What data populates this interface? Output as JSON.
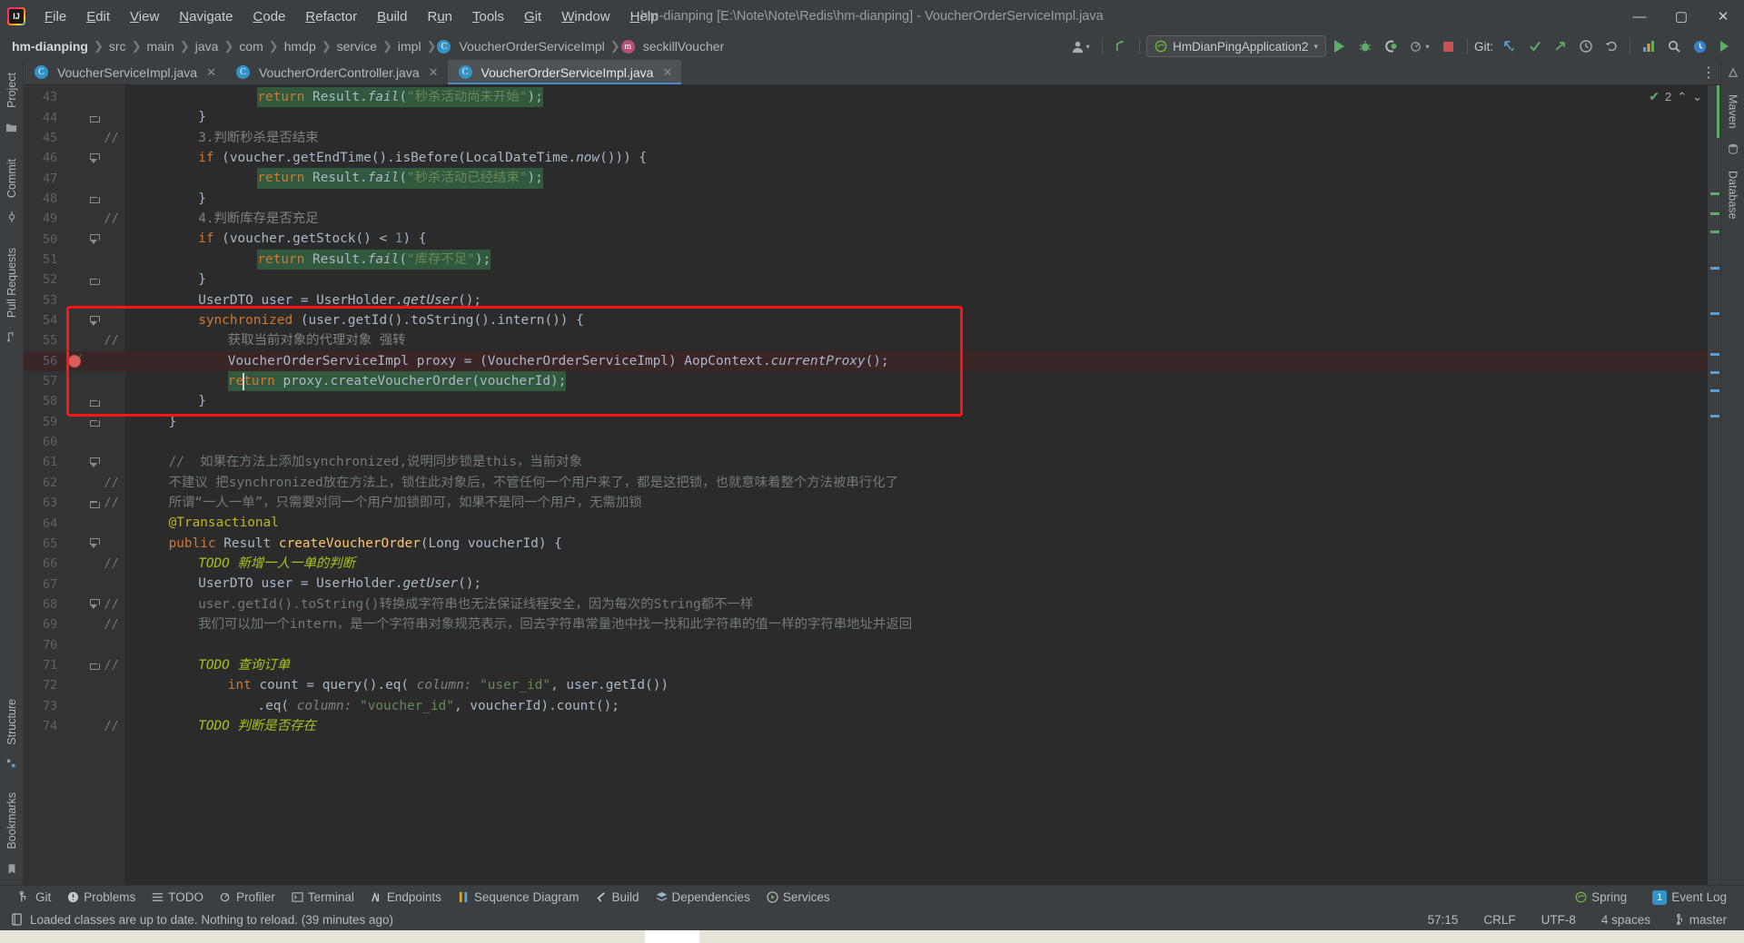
{
  "window": {
    "title": "hm-dianping [E:\\Note\\Note\\Redis\\hm-dianping] - VoucherOrderServiceImpl.java",
    "minimize": "—",
    "maximize": "▢",
    "close": "✕"
  },
  "menubar": {
    "items": [
      "File",
      "Edit",
      "View",
      "Navigate",
      "Code",
      "Refactor",
      "Build",
      "Run",
      "Tools",
      "Git",
      "Window",
      "Help"
    ]
  },
  "breadcrumb": {
    "items": [
      {
        "label": "hm-dianping",
        "icon": "",
        "bold": true
      },
      {
        "label": "src",
        "icon": "",
        "bold": false
      },
      {
        "label": "main",
        "icon": "",
        "bold": false
      },
      {
        "label": "java",
        "icon": "",
        "bold": false
      },
      {
        "label": "com",
        "icon": "",
        "bold": false
      },
      {
        "label": "hmdp",
        "icon": "",
        "bold": false
      },
      {
        "label": "service",
        "icon": "",
        "bold": false
      },
      {
        "label": "impl",
        "icon": "",
        "bold": false
      },
      {
        "label": "VoucherOrderServiceImpl",
        "icon": "C",
        "bold": false
      },
      {
        "label": "seckillVoucher",
        "icon": "m",
        "bold": false
      }
    ],
    "separator": "❯"
  },
  "toolbar": {
    "run_config": "HmDianPingApplication2",
    "run_config_caret": "▾",
    "git_label": "Git:",
    "avatar_caret": "▾",
    "profiler_caret": "▾",
    "icons": {
      "run": "run-icon",
      "debug": "debug-icon",
      "coverage": "coverage-icon",
      "profile": "profile-icon",
      "stop": "stop-icon",
      "update": "git-update-icon",
      "commit": "git-commit-icon",
      "push": "git-push-icon",
      "history": "history-icon",
      "rollback": "rollback-icon",
      "analyze": "analyze-icon",
      "search": "search-icon",
      "settings": "settings-icon",
      "play_all": "play-all-icon"
    }
  },
  "tabs": [
    {
      "label": "VoucherServiceImpl.java",
      "icon": "C",
      "active": false,
      "close": "✕"
    },
    {
      "label": "VoucherOrderController.java",
      "icon": "C",
      "active": false,
      "close": "✕"
    },
    {
      "label": "VoucherOrderServiceImpl.java",
      "icon": "C",
      "active": true,
      "close": "✕"
    }
  ],
  "tab_overflow": "⋮",
  "left_rail": [
    {
      "label": "Project",
      "icon": "project-icon"
    },
    {
      "label": "Commit",
      "icon": "commit-icon"
    },
    {
      "label": "Pull Requests",
      "icon": "pull-requests-icon"
    },
    {
      "label": "Structure",
      "icon": "structure-icon"
    },
    {
      "label": "Bookmarks",
      "icon": "bookmarks-icon"
    }
  ],
  "right_rail": [
    {
      "label": "Maven",
      "icon": "maven-icon"
    },
    {
      "label": "Database",
      "icon": "database-icon"
    }
  ],
  "inspection": {
    "warning_count": "2",
    "ok_icon": "✔",
    "up_arrow": "⌃",
    "down_arrow": "⌄"
  },
  "editor": {
    "lines": [
      {
        "n": "43",
        "fold": "",
        "cmt": "",
        "bp": false,
        "indent": 4,
        "highlight": "",
        "tokens": [
          {
            "t": "return ",
            "c": "kw"
          },
          {
            "t": "Result.",
            "c": "ident"
          },
          {
            "t": "fail",
            "c": "methi"
          },
          {
            "t": "(",
            "c": "ident"
          },
          {
            "t": "\"秒杀活动尚未开始\"",
            "c": "str"
          },
          {
            "t": ");",
            "c": "ident"
          }
        ],
        "strbg": true
      },
      {
        "n": "44",
        "fold": "close",
        "cmt": "",
        "bp": false,
        "indent": 2,
        "highlight": "",
        "tokens": [
          {
            "t": "}",
            "c": "ident"
          }
        ]
      },
      {
        "n": "45",
        "fold": "",
        "cmt": "//",
        "bp": false,
        "indent": 2,
        "highlight": "",
        "tokens": [
          {
            "t": "3.判断秒杀是否结束",
            "c": "cmt"
          }
        ]
      },
      {
        "n": "46",
        "fold": "open",
        "cmt": "",
        "bp": false,
        "indent": 2,
        "highlight": "",
        "tokens": [
          {
            "t": "if",
            "c": "kw"
          },
          {
            "t": " (voucher.",
            "c": "ident"
          },
          {
            "t": "getEndTime",
            "c": "ident"
          },
          {
            "t": "().",
            "c": "ident"
          },
          {
            "t": "isBefore",
            "c": "ident"
          },
          {
            "t": "(LocalDateTime.",
            "c": "ident"
          },
          {
            "t": "now",
            "c": "methi"
          },
          {
            "t": "())) {",
            "c": "ident"
          }
        ]
      },
      {
        "n": "47",
        "fold": "",
        "cmt": "",
        "bp": false,
        "indent": 4,
        "highlight": "",
        "tokens": [
          {
            "t": "return ",
            "c": "kw"
          },
          {
            "t": "Result.",
            "c": "ident"
          },
          {
            "t": "fail",
            "c": "methi"
          },
          {
            "t": "(",
            "c": "ident"
          },
          {
            "t": "\"秒杀活动已经结束\"",
            "c": "str"
          },
          {
            "t": ");",
            "c": "ident"
          }
        ],
        "strbg": true
      },
      {
        "n": "48",
        "fold": "close",
        "cmt": "",
        "bp": false,
        "indent": 2,
        "highlight": "",
        "tokens": [
          {
            "t": "}",
            "c": "ident"
          }
        ]
      },
      {
        "n": "49",
        "fold": "",
        "cmt": "//",
        "bp": false,
        "indent": 2,
        "highlight": "",
        "tokens": [
          {
            "t": "4.判断库存是否充足",
            "c": "cmt"
          }
        ]
      },
      {
        "n": "50",
        "fold": "open",
        "cmt": "",
        "bp": false,
        "indent": 2,
        "highlight": "",
        "tokens": [
          {
            "t": "if",
            "c": "kw"
          },
          {
            "t": " (voucher.",
            "c": "ident"
          },
          {
            "t": "getStock",
            "c": "ident"
          },
          {
            "t": "() < ",
            "c": "ident"
          },
          {
            "t": "1",
            "c": "num"
          },
          {
            "t": ") {",
            "c": "ident"
          }
        ]
      },
      {
        "n": "51",
        "fold": "",
        "cmt": "",
        "bp": false,
        "indent": 4,
        "highlight": "",
        "tokens": [
          {
            "t": "return ",
            "c": "kw"
          },
          {
            "t": "Result.",
            "c": "ident"
          },
          {
            "t": "fail",
            "c": "methi"
          },
          {
            "t": "(",
            "c": "ident"
          },
          {
            "t": "\"库存不足\"",
            "c": "str"
          },
          {
            "t": ");",
            "c": "ident"
          }
        ],
        "strbg": true
      },
      {
        "n": "52",
        "fold": "close",
        "cmt": "",
        "bp": false,
        "indent": 2,
        "highlight": "",
        "tokens": [
          {
            "t": "}",
            "c": "ident"
          }
        ]
      },
      {
        "n": "53",
        "fold": "",
        "cmt": "",
        "bp": false,
        "indent": 2,
        "highlight": "",
        "tokens": [
          {
            "t": "UserDTO user = UserHolder.",
            "c": "ident"
          },
          {
            "t": "getUser",
            "c": "methi"
          },
          {
            "t": "();",
            "c": "ident"
          }
        ]
      },
      {
        "n": "54",
        "fold": "open",
        "cmt": "",
        "bp": false,
        "indent": 2,
        "highlight": "",
        "tokens": [
          {
            "t": "synchronized",
            "c": "kw"
          },
          {
            "t": " (user.",
            "c": "ident"
          },
          {
            "t": "getId",
            "c": "ident"
          },
          {
            "t": "().",
            "c": "ident"
          },
          {
            "t": "toString",
            "c": "ident"
          },
          {
            "t": "().",
            "c": "ident"
          },
          {
            "t": "intern",
            "c": "ident"
          },
          {
            "t": "()) {",
            "c": "ident"
          }
        ]
      },
      {
        "n": "55",
        "fold": "",
        "cmt": "//",
        "bp": false,
        "indent": 3,
        "highlight": "",
        "tokens": [
          {
            "t": "获取当前对象的代理对象 强转",
            "c": "cmt"
          }
        ]
      },
      {
        "n": "56",
        "fold": "",
        "cmt": "",
        "bp": true,
        "indent": 3,
        "highlight": "bp",
        "tokens": [
          {
            "t": "VoucherOrderServiceImpl proxy = (VoucherOrderServiceImpl) AopContext.",
            "c": "ident"
          },
          {
            "t": "currentProxy",
            "c": "methi"
          },
          {
            "t": "();",
            "c": "ident"
          }
        ]
      },
      {
        "n": "57",
        "fold": "",
        "cmt": "",
        "bp": false,
        "indent": 3,
        "highlight": "",
        "tokens": [
          {
            "t": "return",
            "c": "kw"
          },
          {
            "t": " proxy.",
            "c": "ident"
          },
          {
            "t": "createVoucherOrder",
            "c": "ident"
          },
          {
            "t": "(voucherId);",
            "c": "ident"
          }
        ],
        "strbg": true,
        "caret": true
      },
      {
        "n": "58",
        "fold": "close",
        "cmt": "",
        "bp": false,
        "indent": 2,
        "highlight": "",
        "tokens": [
          {
            "t": "}",
            "c": "ident"
          }
        ]
      },
      {
        "n": "59",
        "fold": "close",
        "cmt": "",
        "bp": false,
        "indent": 1,
        "highlight": "",
        "tokens": [
          {
            "t": "}",
            "c": "ident"
          }
        ]
      },
      {
        "n": "60",
        "fold": "",
        "cmt": "",
        "bp": false,
        "indent": 0,
        "highlight": "",
        "tokens": []
      },
      {
        "n": "61",
        "fold": "open",
        "cmt": "",
        "bp": false,
        "indent": 1,
        "highlight": "",
        "tokens": [
          {
            "t": "//  如果在方法上添加synchronized,说明同步锁是this，当前对象",
            "c": "cmt2"
          }
        ]
      },
      {
        "n": "62",
        "fold": "",
        "cmt": "//",
        "bp": false,
        "indent": 1,
        "highlight": "",
        "tokens": [
          {
            "t": "不建议 把synchronized放在方法上，锁住此对象后，不管任何一个用户来了，都是这把锁，也就意味着整个方法被串行化了",
            "c": "cmt2"
          }
        ]
      },
      {
        "n": "63",
        "fold": "close",
        "cmt": "//",
        "bp": false,
        "indent": 1,
        "highlight": "",
        "tokens": [
          {
            "t": "所谓“一人一单”，只需要对同一个用户加锁即可，如果不是同一个用户，无需加锁",
            "c": "cmt2"
          }
        ]
      },
      {
        "n": "64",
        "fold": "",
        "cmt": "",
        "bp": false,
        "indent": 1,
        "highlight": "",
        "tokens": [
          {
            "t": "@Transactional",
            "c": "anno"
          }
        ]
      },
      {
        "n": "65",
        "fold": "open",
        "cmt": "",
        "bp": false,
        "indent": 1,
        "highlight": "",
        "tokens": [
          {
            "t": "public ",
            "c": "kw"
          },
          {
            "t": "Result ",
            "c": "ident"
          },
          {
            "t": "createVoucherOrder",
            "c": "meth"
          },
          {
            "t": "(Long voucherId) {",
            "c": "ident"
          }
        ]
      },
      {
        "n": "66",
        "fold": "",
        "cmt": "//",
        "bp": false,
        "indent": 2,
        "highlight": "",
        "tokens": [
          {
            "t": "TODO ",
            "c": "todo"
          },
          {
            "t": "新增一人一单的判断",
            "c": "todo"
          }
        ]
      },
      {
        "n": "67",
        "fold": "",
        "cmt": "",
        "bp": false,
        "indent": 2,
        "highlight": "",
        "tokens": [
          {
            "t": "UserDTO user = UserHolder.",
            "c": "ident"
          },
          {
            "t": "getUser",
            "c": "methi"
          },
          {
            "t": "();",
            "c": "ident"
          }
        ]
      },
      {
        "n": "68",
        "fold": "open",
        "cmt": "//",
        "bp": false,
        "indent": 2,
        "highlight": "",
        "tokens": [
          {
            "t": "user.getId().toString()转换成字符串也无法保证线程安全，因为每次的String都不一样",
            "c": "cmt2"
          }
        ]
      },
      {
        "n": "69",
        "fold": "",
        "cmt": "//",
        "bp": false,
        "indent": 2,
        "highlight": "",
        "tokens": [
          {
            "t": "我们可以加一个intern，是一个字符串对象规范表示，回去字符串常量池中找一找和此字符串的值一样的字符串地址并返回",
            "c": "cmt2"
          }
        ]
      },
      {
        "n": "70",
        "fold": "",
        "cmt": "",
        "bp": false,
        "indent": 0,
        "highlight": "",
        "tokens": []
      },
      {
        "n": "71",
        "fold": "close",
        "cmt": "//",
        "bp": false,
        "indent": 2,
        "highlight": "",
        "tokens": [
          {
            "t": "TODO ",
            "c": "todo"
          },
          {
            "t": "查询订单",
            "c": "todo"
          }
        ]
      },
      {
        "n": "72",
        "fold": "",
        "cmt": "",
        "bp": false,
        "indent": 3,
        "highlight": "",
        "tokens": [
          {
            "t": "int ",
            "c": "kw"
          },
          {
            "t": "count = ",
            "c": "ident"
          },
          {
            "t": "query",
            "c": "ident"
          },
          {
            "t": "().",
            "c": "ident"
          },
          {
            "t": "eq",
            "c": "ident"
          },
          {
            "t": "( ",
            "c": "ident"
          },
          {
            "t": "column:",
            "c": "param"
          },
          {
            "t": " ",
            "c": "ident"
          },
          {
            "t": "\"user_id\"",
            "c": "str"
          },
          {
            "t": ", user.",
            "c": "ident"
          },
          {
            "t": "getId",
            "c": "ident"
          },
          {
            "t": "())",
            "c": "ident"
          }
        ]
      },
      {
        "n": "73",
        "fold": "",
        "cmt": "",
        "bp": false,
        "indent": 4,
        "highlight": "",
        "tokens": [
          {
            "t": ".",
            "c": "ident"
          },
          {
            "t": "eq",
            "c": "ident"
          },
          {
            "t": "( ",
            "c": "ident"
          },
          {
            "t": "column:",
            "c": "param"
          },
          {
            "t": " ",
            "c": "ident"
          },
          {
            "t": "\"voucher_id\"",
            "c": "str"
          },
          {
            "t": ", voucherId).",
            "c": "ident"
          },
          {
            "t": "count",
            "c": "ident"
          },
          {
            "t": "();",
            "c": "ident"
          }
        ]
      },
      {
        "n": "74",
        "fold": "",
        "cmt": "//",
        "bp": false,
        "indent": 2,
        "highlight": "",
        "tokens": [
          {
            "t": "TODO ",
            "c": "todo"
          },
          {
            "t": "判断是否存在",
            "c": "todo"
          }
        ]
      }
    ],
    "annotation_box": {
      "color": "#fe1414",
      "label": "synchronized-block-highlight"
    }
  },
  "bottom_tools": [
    {
      "label": "Git",
      "icon": "git-icon"
    },
    {
      "label": "Problems",
      "icon": "problems-icon"
    },
    {
      "label": "TODO",
      "icon": "todo-icon"
    },
    {
      "label": "Profiler",
      "icon": "profiler-icon"
    },
    {
      "label": "Terminal",
      "icon": "terminal-icon"
    },
    {
      "label": "Endpoints",
      "icon": "endpoints-icon"
    },
    {
      "label": "Sequence Diagram",
      "icon": "sequence-diagram-icon"
    },
    {
      "label": "Build",
      "icon": "build-icon"
    },
    {
      "label": "Dependencies",
      "icon": "dependencies-icon"
    },
    {
      "label": "Services",
      "icon": "services-icon"
    }
  ],
  "bottom_right": {
    "spring": "Spring",
    "event_log": "Event Log",
    "event_log_count": "1"
  },
  "status": {
    "message": "Loaded classes are up to date. Nothing to reload. (39 minutes ago)",
    "caret": "57:15",
    "line_sep": "CRLF",
    "encoding": "UTF-8",
    "indent": "4 spaces",
    "branch": "master"
  },
  "colors": {
    "accent": "#4a88c7",
    "annotation_red": "#fe1414",
    "green": "#5fad65",
    "editor_bg": "#2b2b2b",
    "chrome_bg": "#3c3f41"
  }
}
